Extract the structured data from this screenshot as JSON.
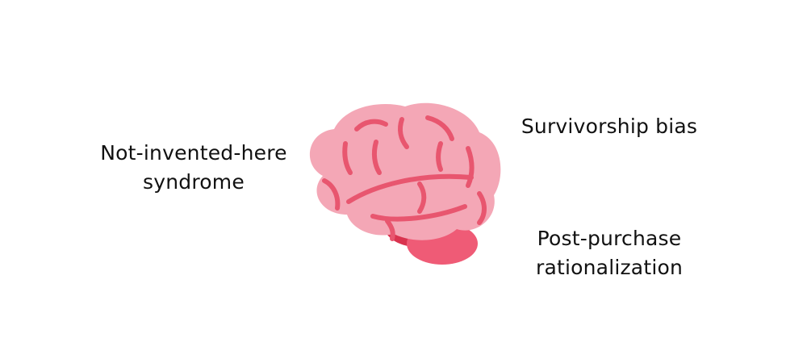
{
  "labels": {
    "left": {
      "line1": "Not-invented-here",
      "line2": "syndrome"
    },
    "right_top": {
      "line1": "Survivorship bias"
    },
    "right_bottom": {
      "line1": "Post-purchase",
      "line2": "rationalization"
    }
  },
  "illustration": {
    "icon": "brain-icon",
    "colors": {
      "cerebrum": "#f4a7b6",
      "folds": "#e8566f",
      "cerebellum": "#ef5b76",
      "stem": "#d9334f"
    }
  }
}
